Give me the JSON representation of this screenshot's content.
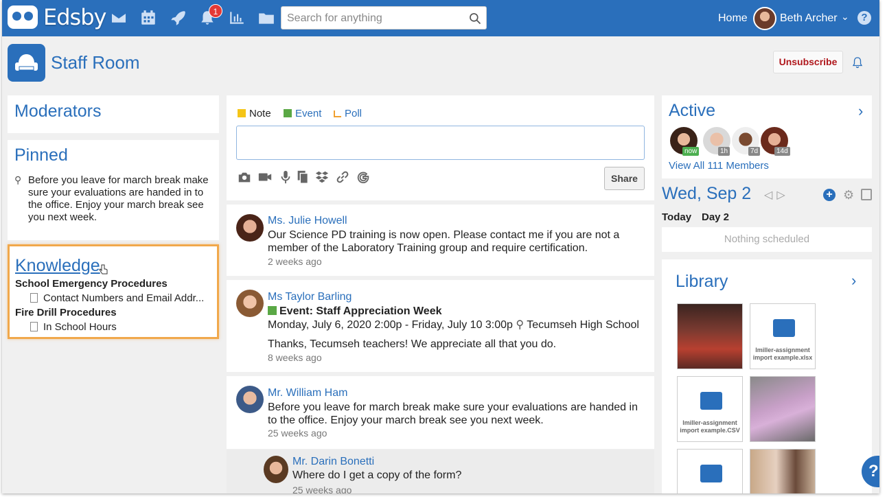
{
  "app": {
    "logo_text": "Edsby"
  },
  "colors": {
    "brand": "#2a6fbb",
    "highlight": "#f1a84b",
    "danger": "#b0171c",
    "badge": "#e53935"
  },
  "nav": {
    "icons": [
      "mail-icon",
      "calendar-icon",
      "rocket-icon",
      "bell-icon",
      "chart-icon",
      "folder-icon"
    ],
    "notification_count": "1",
    "search_placeholder": "Search for anything",
    "home_label": "Home",
    "user_name": "Beth Archer",
    "help_label": "?"
  },
  "header": {
    "title": "Staff Room",
    "unsubscribe_label": "Unsubscribe"
  },
  "left": {
    "moderators_title": "Moderators",
    "pinned_title": "Pinned",
    "pinned_text": "Before you leave for march break make sure your evaluations are handed in to the office. Enjoy your march break see you next week.",
    "knowledge_title": "Knowledge",
    "knowledge": [
      {
        "category": "School Emergency Procedures",
        "item": "Contact Numbers and Email Addr..."
      },
      {
        "category": "Fire Drill Procedures",
        "item": "In School Hours"
      }
    ]
  },
  "composer": {
    "types": [
      "Note",
      "Event",
      "Poll"
    ],
    "share_label": "Share",
    "tools": [
      "camera-icon",
      "video-icon",
      "microphone-icon",
      "documents-icon",
      "dropbox-icon",
      "link-icon",
      "google-icon"
    ]
  },
  "posts": [
    {
      "author": "Ms. Julie Howell",
      "body": "Our Science PD training is now open. Please contact me if you are not a member of the Laboratory Training group and require certification.",
      "time": "2 weeks ago"
    },
    {
      "author": "Ms Taylor Barling",
      "event_title": "Event: Staff Appreciation Week",
      "event_when": "Monday, July 6, 2020 2:00p - Friday, July 10 3:00p",
      "event_where": "Tecumseh High School",
      "body": "Thanks, Tecumseh teachers! We appreciate all that you do.",
      "time": "8 weeks ago"
    },
    {
      "author": "Mr. William Ham",
      "body": "Before you leave for march break make sure your evaluations are handed in to the office. Enjoy your march break see you next week.",
      "time": "25 weeks ago"
    }
  ],
  "reply": {
    "author": "Mr. Darin Bonetti",
    "body": "Where do I get a copy of the form?",
    "time": "25 weeks ago"
  },
  "right": {
    "active_title": "Active",
    "members": [
      {
        "badge": "now"
      },
      {
        "badge": "1h"
      },
      {
        "badge": "7d"
      },
      {
        "badge": "14d"
      }
    ],
    "view_all": "View All 111 Members",
    "date_title": "Wed, Sep 2",
    "today_label": "Today",
    "day_label": "Day 2",
    "nothing_scheduled": "Nothing scheduled",
    "library_title": "Library",
    "library_files": [
      {
        "name": ""
      },
      {
        "name": "lmiller-assignment import example.xlsx"
      },
      {
        "name": "lmiller-assignment import example.CSV"
      },
      {
        "name": ""
      },
      {
        "name": ""
      },
      {
        "name": ""
      }
    ]
  },
  "help_fab_label": "?"
}
